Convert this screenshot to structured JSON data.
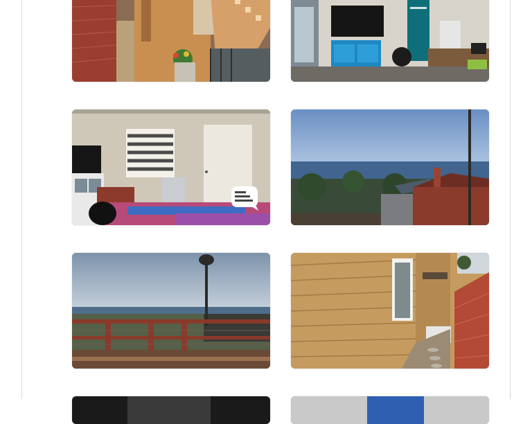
{
  "gallery": {
    "items": [
      {
        "scene": "side-yard-stairs"
      },
      {
        "scene": "living-room-tv"
      },
      {
        "scene": "bedroom-window"
      },
      {
        "scene": "ocean-view-rooftops"
      },
      {
        "scene": "deck-ocean-view"
      },
      {
        "scene": "house-side-path"
      },
      {
        "scene": "partial-dark"
      },
      {
        "scene": "partial-light"
      }
    ]
  },
  "colors": {
    "panel_border": "#d9d9d9",
    "background": "#ffffff"
  }
}
